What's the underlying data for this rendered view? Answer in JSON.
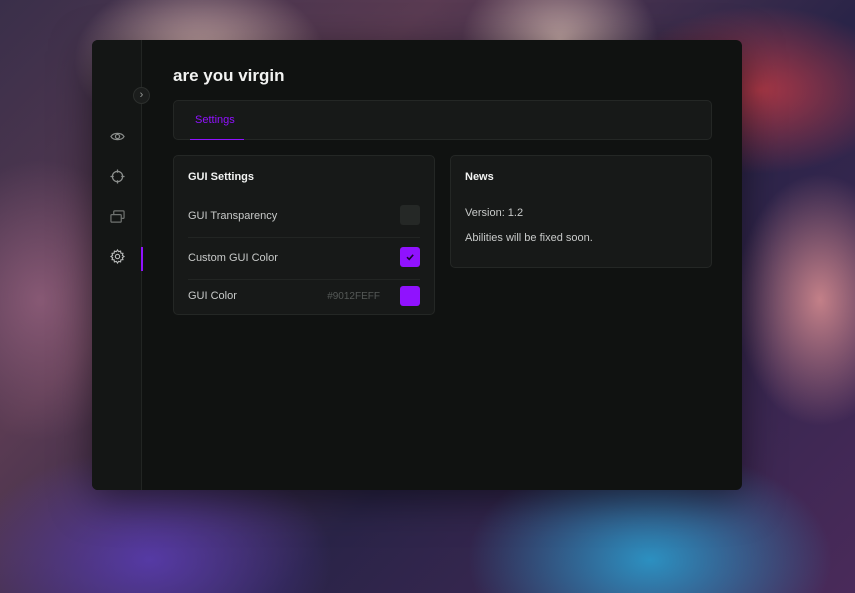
{
  "app": {
    "title": "are you virgin"
  },
  "tabs": [
    {
      "label": "Settings",
      "active": true
    }
  ],
  "sidebar": {
    "items": [
      {
        "icon": "eye-icon",
        "active": false
      },
      {
        "icon": "crosshair-icon",
        "active": false
      },
      {
        "icon": "layers-icon",
        "active": false
      },
      {
        "icon": "gear-icon",
        "active": true
      }
    ]
  },
  "gui_settings": {
    "title": "GUI Settings",
    "transparency": {
      "label": "GUI Transparency",
      "checked": false
    },
    "custom_color": {
      "label": "Custom GUI Color",
      "checked": true
    },
    "gui_color": {
      "label": "GUI Color",
      "value": "#9012FEFF"
    }
  },
  "news": {
    "title": "News",
    "version": "Version: 1.2",
    "message": "Abilities will be fixed soon."
  },
  "colors": {
    "accent": "#9012FE",
    "window_bg": "#101211",
    "card_bg": "#171918"
  }
}
